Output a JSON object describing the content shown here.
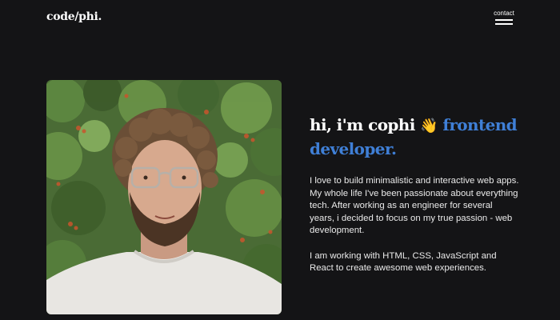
{
  "header": {
    "logo_text": "code/phi.",
    "menu_label": "contact",
    "menu_icon": "hamburger-icon"
  },
  "hero": {
    "photo_alt": "portrait",
    "greeting": "hi, i'm cophi",
    "wave_emoji": "👋",
    "role": "frontend developer.",
    "accent_color": "#3f7fd6",
    "bio_paragraph_1": "I love to build minimalistic and interactive web apps. My whole life I've been passionate about everything tech. After working as an engineer for several years, i decided to focus on my true passion - web development.",
    "bio_paragraph_2": "I am working with HTML, CSS, JavaScript and React to create awesome web experiences."
  }
}
